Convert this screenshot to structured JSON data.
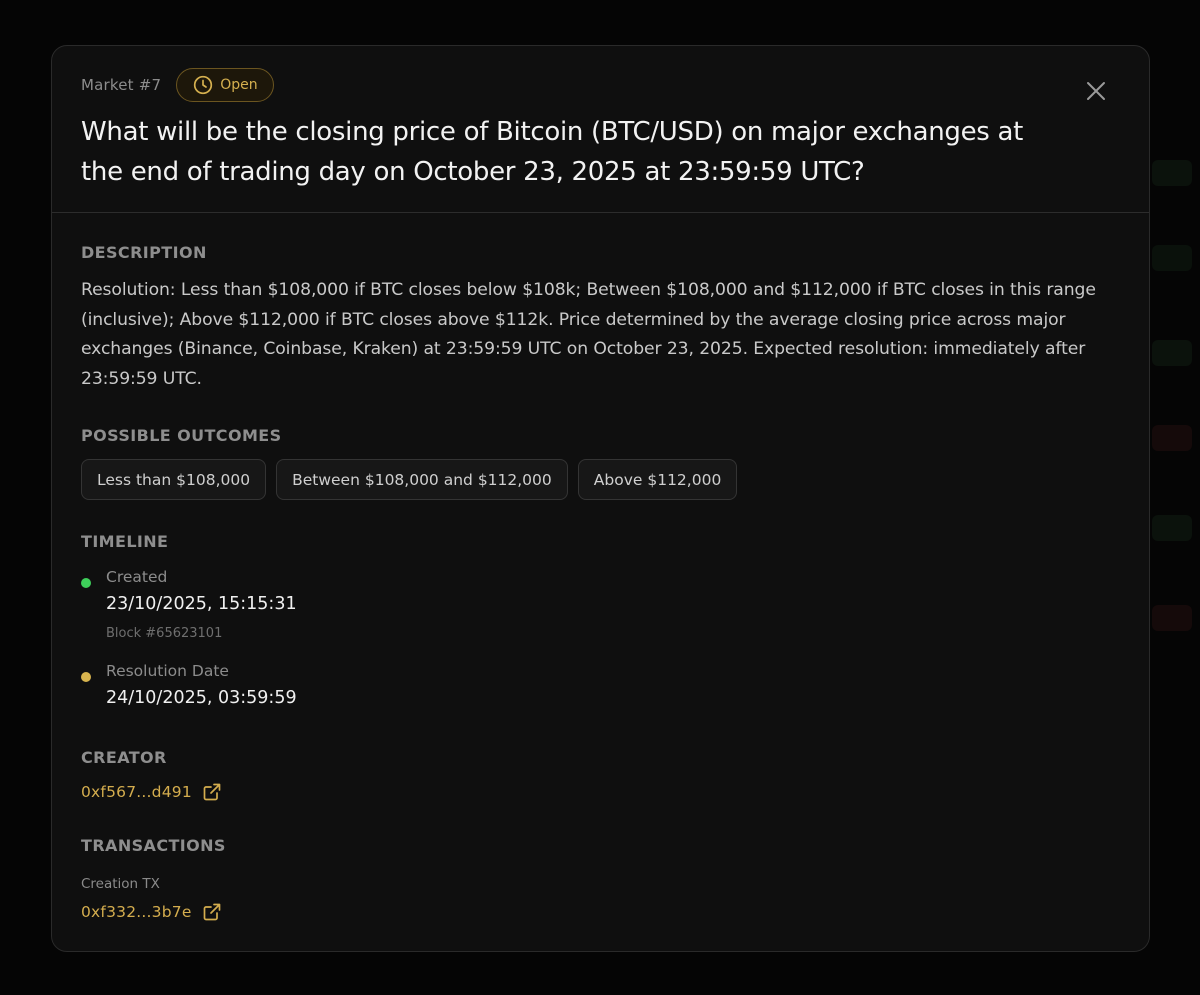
{
  "market": {
    "label": "Market #7",
    "status": "Open",
    "title": "What will be the closing price of Bitcoin (BTC/USD) on major exchanges at the end of trading day on October 23, 2025 at 23:59:59 UTC?"
  },
  "description": {
    "heading": "DESCRIPTION",
    "text": "Resolution: Less than $108,000 if BTC closes below $108k; Between $108,000 and $112,000 if BTC closes in this range (inclusive); Above $112,000 if BTC closes above $112k. Price determined by the average closing price across major exchanges (Binance, Coinbase, Kraken) at 23:59:59 UTC on October 23, 2025. Expected resolution: immediately after 23:59:59 UTC."
  },
  "outcomes": {
    "heading": "POSSIBLE OUTCOMES",
    "items": [
      "Less than $108,000",
      "Between $108,000 and $112,000",
      "Above $112,000"
    ]
  },
  "timeline": {
    "heading": "TIMELINE",
    "created": {
      "title": "Created",
      "date": "23/10/2025, 15:15:31",
      "block": "Block #65623101",
      "dot_color": "#3ecf5a"
    },
    "resolution": {
      "title": "Resolution Date",
      "date": "24/10/2025, 03:59:59",
      "dot_color": "#d8b44e"
    }
  },
  "creator": {
    "heading": "CREATOR",
    "address": "0xf567...d491"
  },
  "transactions": {
    "heading": "TRANSACTIONS",
    "creation_label": "Creation TX",
    "creation_hash": "0xf332...3b7e"
  },
  "colors": {
    "accent": "#d4ad4e",
    "background": "#0f0f0f"
  },
  "icons": {
    "status": "clock-icon",
    "close": "close-icon",
    "external": "external-link-icon"
  }
}
